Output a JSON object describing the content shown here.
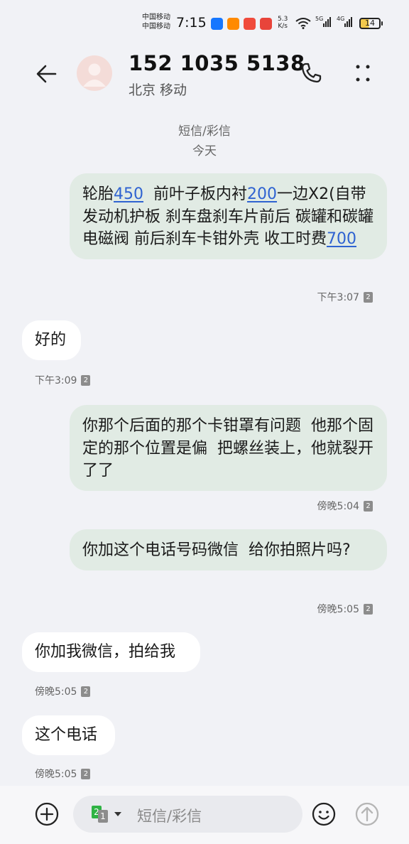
{
  "status": {
    "carrier1": "中国移动",
    "carrier2": "中国移动",
    "time": "7:15",
    "speed_top": "5.3",
    "speed_bottom": "K/s",
    "net1": "5G",
    "net2": "4G",
    "battery": "14"
  },
  "header": {
    "contact": "152 1035 5138",
    "location": "北京 移动"
  },
  "thread": {
    "type_label": "短信/彩信",
    "date_label": "今天"
  },
  "messages": [
    {
      "direction": "sent",
      "segments": [
        "轮胎",
        "450",
        "  前叶子板内衬",
        "200",
        "一边X2",
        "(自带发动机护板 刹车盘刹车片前后 碳罐和碳罐电磁阀 前后刹车卡钳外壳 收工时费",
        "700"
      ],
      "time": "下午3:07",
      "sim": "2"
    },
    {
      "direction": "received",
      "text": "好的",
      "time": "下午3:09",
      "sim": "2"
    },
    {
      "direction": "sent",
      "text": "你那个后面的那个卡钳罩有问题  他那个固定的那个位置是偏  把螺丝装上，他就裂开了了",
      "time": "傍晚5:04",
      "sim": "2"
    },
    {
      "direction": "sent",
      "text": "你加这个电话号码微信  给你拍照片吗?",
      "time": "傍晚5:05",
      "sim": "2"
    },
    {
      "direction": "received",
      "text": "你加我微信，拍给我",
      "time": "傍晚5:05",
      "sim": "2"
    },
    {
      "direction": "received",
      "text": "这个电话",
      "time": "傍晚5:05",
      "sim": "2"
    }
  ],
  "input": {
    "placeholder": "短信/彩信",
    "sim_selected": "2",
    "sim_other": "1"
  },
  "colors": {
    "sent_bubble": "#e1ebe4",
    "received_bubble": "#ffffff",
    "link": "#2f63d1",
    "background": "#f1f2f6"
  },
  "icons": [
    "back-arrow-icon",
    "avatar-person-icon",
    "phone-icon",
    "more-vertical-icon",
    "plus-circle-icon",
    "sim-selector-icon",
    "chevron-down-icon",
    "emoji-icon",
    "send-arrow-icon"
  ]
}
